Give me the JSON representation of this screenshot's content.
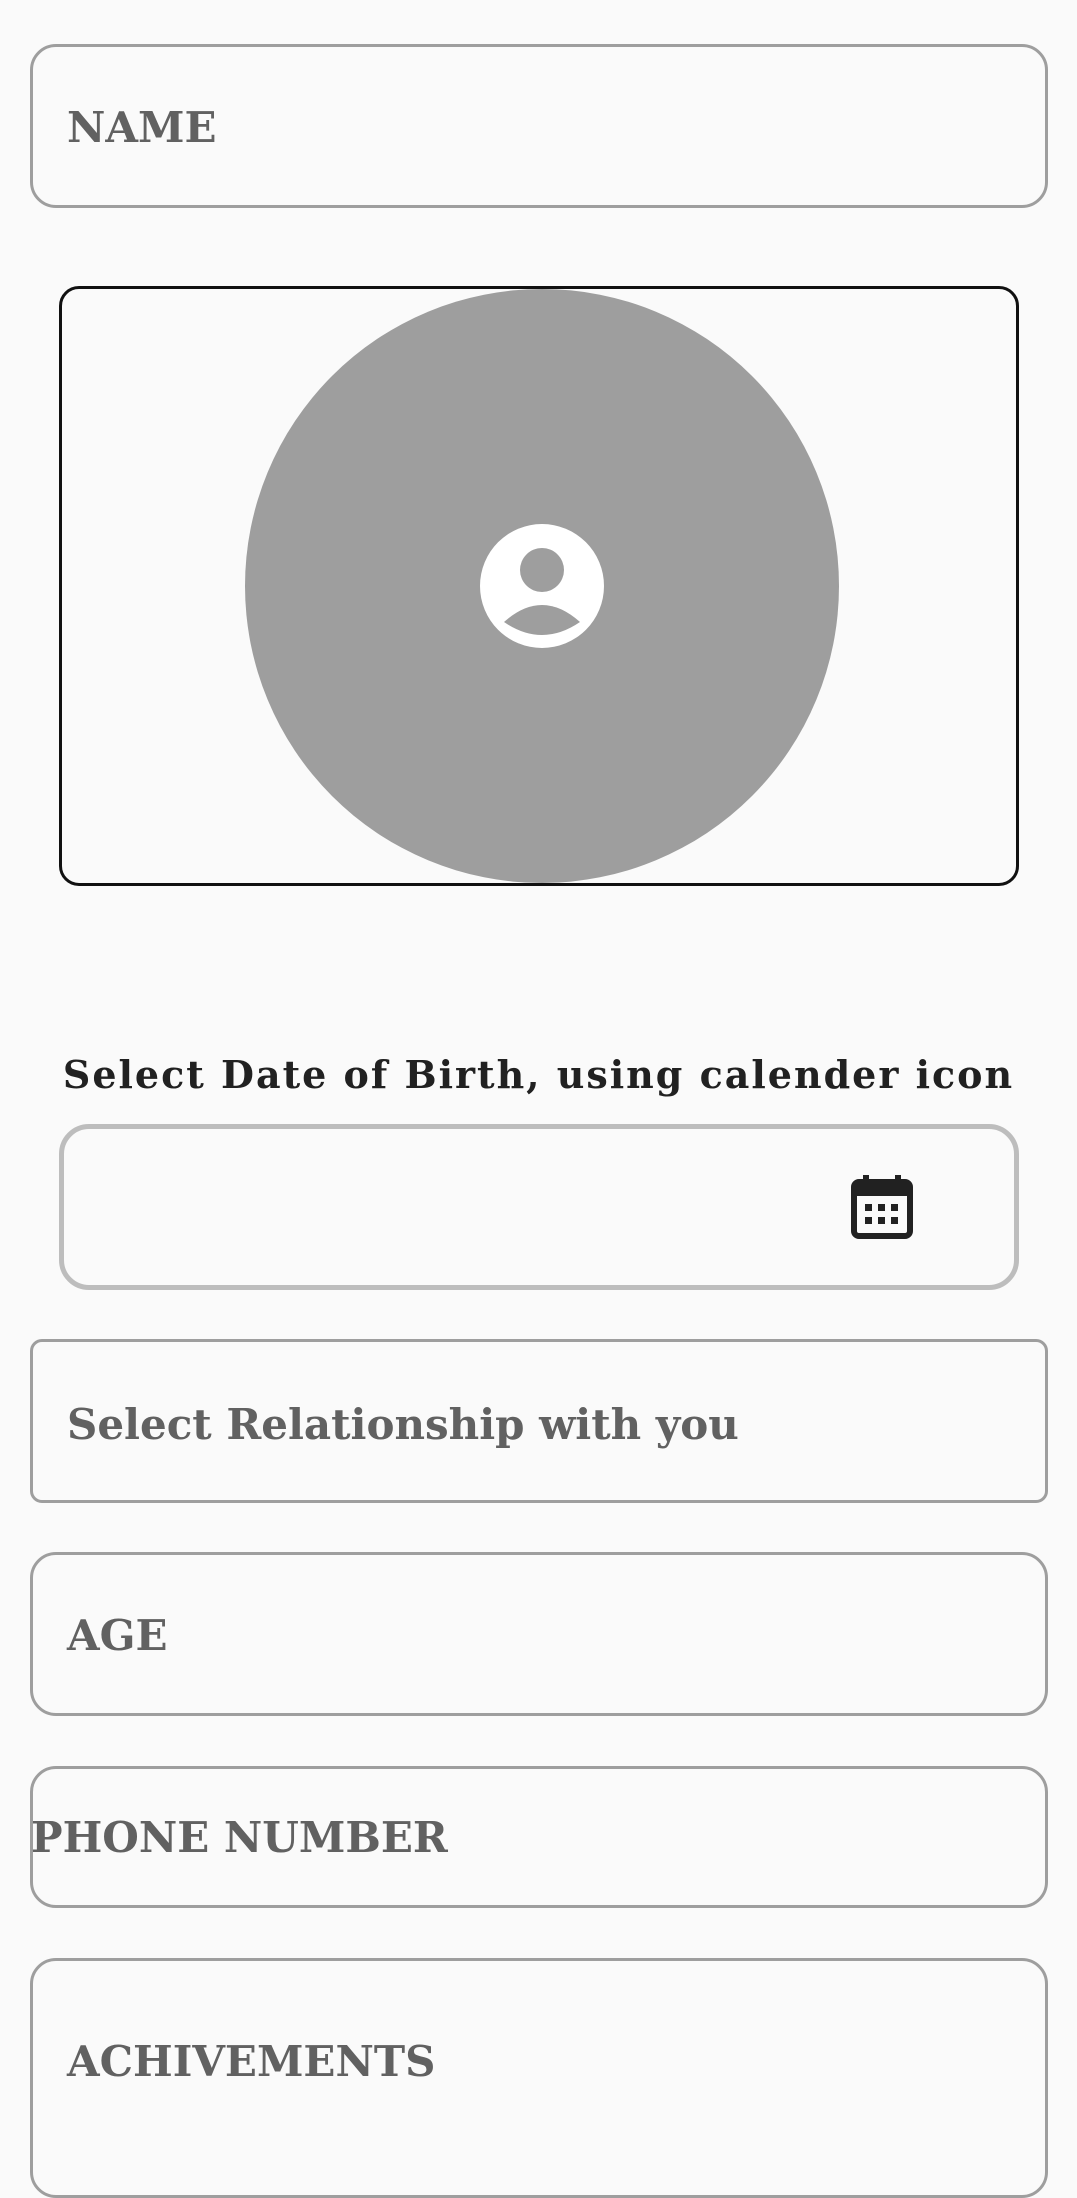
{
  "form": {
    "name_placeholder": "NAME",
    "photo": {
      "icon": "account-circle-icon"
    },
    "dob": {
      "instruction": "Select Date of Birth, using calender icon",
      "value": "",
      "icon": "calendar-icon"
    },
    "relationship_placeholder": "Select Relationship with you",
    "age_placeholder": "AGE",
    "phone_placeholder": "PHONE NUMBER",
    "achievements_placeholder": "ACHIVEMENTS"
  },
  "colors": {
    "background": "#fafafa",
    "field_border": "#9e9e9e",
    "placeholder_text": "#616161",
    "avatar_fill": "#9e9e9e",
    "frame_border": "#111111",
    "dob_border": "#bdbdbd"
  }
}
